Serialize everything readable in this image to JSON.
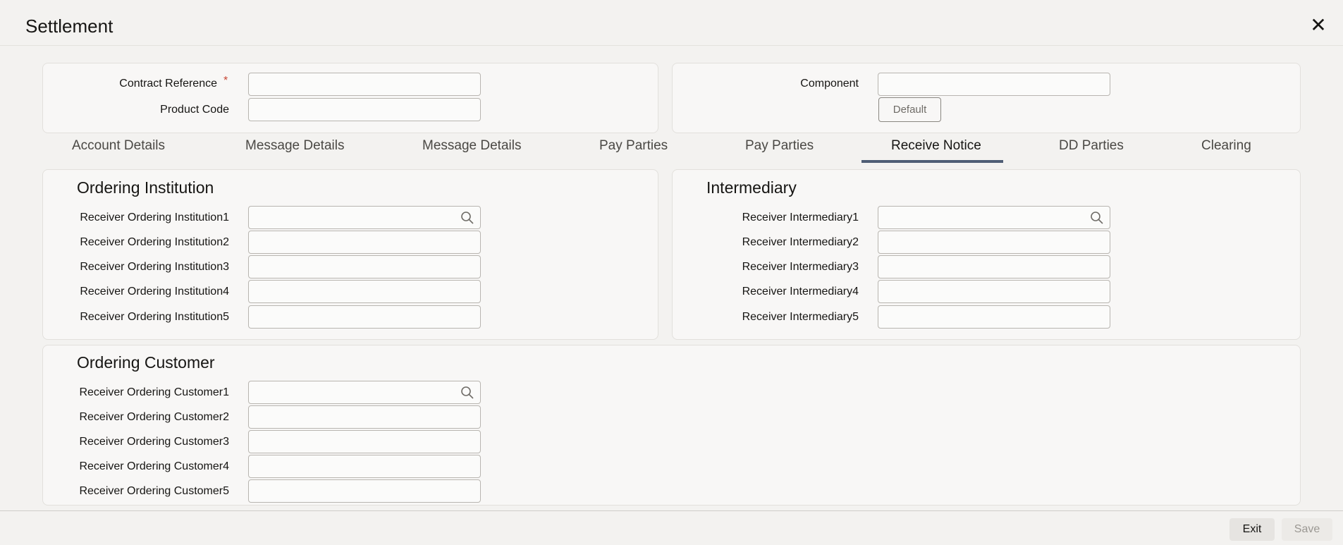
{
  "window": {
    "title": "Settlement"
  },
  "header_panel": {
    "contract_reference_label": "Contract Reference",
    "required_mark": "*",
    "product_code_label": "Product Code",
    "component_label": "Component",
    "default_button": "Default"
  },
  "tabs": [
    {
      "label": "Account Details",
      "active": false
    },
    {
      "label": "Message Details",
      "active": false
    },
    {
      "label": "Message Details",
      "active": false
    },
    {
      "label": "Pay Parties",
      "active": false
    },
    {
      "label": "Pay Parties",
      "active": false
    },
    {
      "label": "Receive Notice",
      "active": true
    },
    {
      "label": "DD Parties",
      "active": false
    },
    {
      "label": "Clearing",
      "active": false
    }
  ],
  "ordering_institution": {
    "title": "Ordering Institution",
    "fields": [
      "Receiver Ordering Institution1",
      "Receiver Ordering Institution2",
      "Receiver Ordering Institution3",
      "Receiver Ordering Institution4",
      "Receiver Ordering Institution5"
    ]
  },
  "intermediary": {
    "title": "Intermediary",
    "fields": [
      "Receiver Intermediary1",
      "Receiver Intermediary2",
      "Receiver Intermediary3",
      "Receiver Intermediary4",
      "Receiver Intermediary5"
    ]
  },
  "ordering_customer": {
    "title": "Ordering Customer",
    "fields": [
      "Receiver Ordering Customer1",
      "Receiver Ordering Customer2",
      "Receiver Ordering Customer3",
      "Receiver Ordering Customer4",
      "Receiver Ordering Customer5"
    ]
  },
  "footer": {
    "exit": "Exit",
    "save": "Save"
  },
  "colors": {
    "accent_tab": "#4f5e75",
    "required": "#c74634"
  },
  "icons": {
    "close": "close-icon",
    "lookup": "search-icon"
  }
}
